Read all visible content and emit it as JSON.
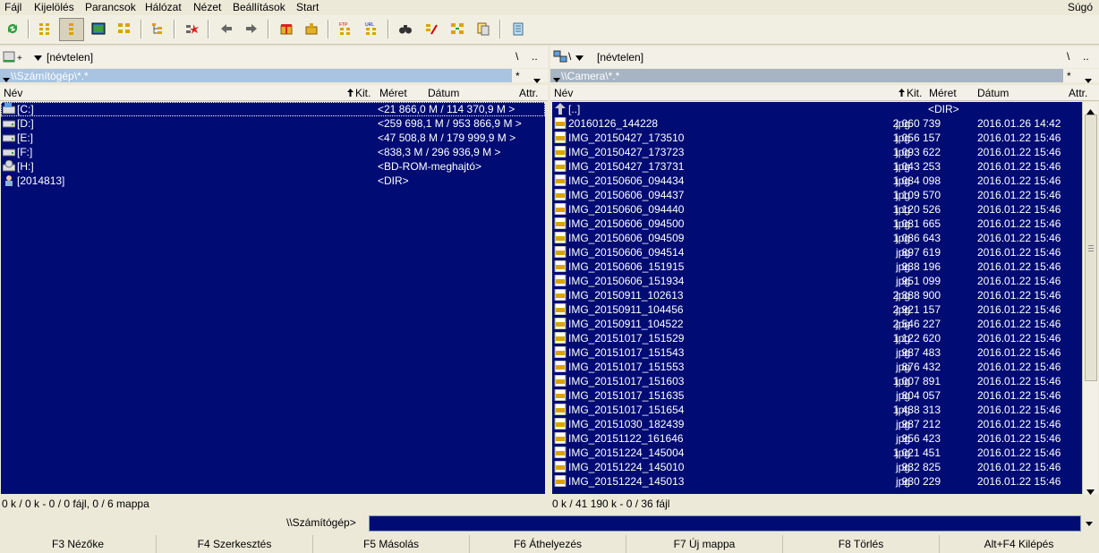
{
  "menu": {
    "items": [
      "Fájl",
      "Kijelölés",
      "Parancsok",
      "Hálózat",
      "Nézet",
      "Beállítások",
      "Start"
    ],
    "help": "Súgó"
  },
  "toolbar": {
    "icons": [
      "refresh-icon",
      "brief-view-icon",
      "detail-view-icon",
      "thumbnail-view-icon",
      "tree-view-icon",
      "invert-selection-icon",
      "back-icon",
      "forward-icon",
      "pack-icon",
      "unpack-icon",
      "ftp-connect-icon",
      "url-connect-icon",
      "find-icon",
      "multi-rename-icon",
      "sync-dirs-icon",
      "copy-names-icon",
      "notepad-icon"
    ]
  },
  "left": {
    "drive_label": "[névtelen]",
    "root_btn": "\\",
    "up_btn": "..",
    "path": "\\\\Számítógép\\*.*",
    "filter_btn": "*",
    "headers": {
      "name": "Név",
      "ext": "Kit.",
      "size": "Méret",
      "date": "Dátum",
      "attr": "Attr."
    },
    "rows": [
      {
        "name": "[C:]",
        "info": "<21 866,0 M / 114 370,9 M >",
        "icon": "drive-c-icon"
      },
      {
        "name": "[D:]",
        "info": "<259 698,1 M / 953 866,9 M >",
        "icon": "hard-drive-icon"
      },
      {
        "name": "[E:]",
        "info": "<47 508,8 M / 179 999,9 M >",
        "icon": "hard-drive-icon"
      },
      {
        "name": "[F:]",
        "info": "<838,3 M / 296 936,9 M >",
        "icon": "hard-drive-icon"
      },
      {
        "name": "[H:]",
        "info": "<BD-ROM-meghajtó>",
        "icon": "optical-drive-icon"
      },
      {
        "name": "[2014813]",
        "info": "<DIR>",
        "icon": "user-folder-icon"
      }
    ],
    "status": "0 k / 0 k - 0 / 0 fájl, 0 / 6 mappa"
  },
  "right": {
    "drive_label": "[névtelen]",
    "root_btn": "\\",
    "up_btn": "..",
    "drive_letter": "\\",
    "path": "\\\\Camera\\*.*",
    "filter_btn": "*",
    "headers": {
      "name": "Név",
      "ext": "Kit.",
      "size": "Méret",
      "date": "Dátum",
      "attr": "Attr."
    },
    "up_row": {
      "name": "[..]",
      "size": "<DIR>"
    },
    "rows": [
      {
        "name": "20160126_144228",
        "ext": "jpg",
        "size": "2 060 739",
        "date": "2016.01.26 14:42"
      },
      {
        "name": "IMG_20150427_173510",
        "ext": "jpg",
        "size": "1 056 157",
        "date": "2016.01.22 15:46"
      },
      {
        "name": "IMG_20150427_173723",
        "ext": "jpg",
        "size": "1 093 622",
        "date": "2016.01.22 15:46"
      },
      {
        "name": "IMG_20150427_173731",
        "ext": "jpg",
        "size": "1 043 253",
        "date": "2016.01.22 15:46"
      },
      {
        "name": "IMG_20150606_094434",
        "ext": "jpg",
        "size": "1 084 098",
        "date": "2016.01.22 15:46"
      },
      {
        "name": "IMG_20150606_094437",
        "ext": "jpg",
        "size": "1 109 570",
        "date": "2016.01.22 15:46"
      },
      {
        "name": "IMG_20150606_094440",
        "ext": "jpg",
        "size": "1 120 526",
        "date": "2016.01.22 15:46"
      },
      {
        "name": "IMG_20150606_094500",
        "ext": "jpg",
        "size": "1 081 665",
        "date": "2016.01.22 15:46"
      },
      {
        "name": "IMG_20150606_094509",
        "ext": "jpg",
        "size": "1 086 643",
        "date": "2016.01.22 15:46"
      },
      {
        "name": "IMG_20150606_094514",
        "ext": "jpg",
        "size": "897 619",
        "date": "2016.01.22 15:46"
      },
      {
        "name": "IMG_20150606_151915",
        "ext": "jpg",
        "size": "938 196",
        "date": "2016.01.22 15:46"
      },
      {
        "name": "IMG_20150606_151934",
        "ext": "jpg",
        "size": "951 099",
        "date": "2016.01.22 15:46"
      },
      {
        "name": "IMG_20150911_102613",
        "ext": "jpg",
        "size": "2 388 900",
        "date": "2016.01.22 15:46"
      },
      {
        "name": "IMG_20150911_104456",
        "ext": "jpg",
        "size": "2 921 157",
        "date": "2016.01.22 15:46"
      },
      {
        "name": "IMG_20150911_104522",
        "ext": "jpg",
        "size": "2 546 227",
        "date": "2016.01.22 15:46"
      },
      {
        "name": "IMG_20151017_151529",
        "ext": "jpg",
        "size": "1 122 620",
        "date": "2016.01.22 15:46"
      },
      {
        "name": "IMG_20151017_151543",
        "ext": "jpg",
        "size": "987 483",
        "date": "2016.01.22 15:46"
      },
      {
        "name": "IMG_20151017_151553",
        "ext": "jpg",
        "size": "876 432",
        "date": "2016.01.22 15:46"
      },
      {
        "name": "IMG_20151017_151603",
        "ext": "jpg",
        "size": "1 007 891",
        "date": "2016.01.22 15:46"
      },
      {
        "name": "IMG_20151017_151635",
        "ext": "jpg",
        "size": "804 057",
        "date": "2016.01.22 15:46"
      },
      {
        "name": "IMG_20151017_151654",
        "ext": "jpg",
        "size": "1 438 313",
        "date": "2016.01.22 15:46"
      },
      {
        "name": "IMG_20151030_182439",
        "ext": "jpg",
        "size": "987 212",
        "date": "2016.01.22 15:46"
      },
      {
        "name": "IMG_20151122_161646",
        "ext": "jpg",
        "size": "956 423",
        "date": "2016.01.22 15:46"
      },
      {
        "name": "IMG_20151224_145004",
        "ext": "jpg",
        "size": "1 021 451",
        "date": "2016.01.22 15:46"
      },
      {
        "name": "IMG_20151224_145010",
        "ext": "jpg",
        "size": "932 825",
        "date": "2016.01.22 15:46"
      },
      {
        "name": "IMG_20151224_145013",
        "ext": "jpg",
        "size": "930 229",
        "date": "2016.01.22 15:46"
      }
    ],
    "status": "0 k / 41 190 k - 0 / 36 fájl"
  },
  "cmdline": {
    "label": "\\\\Számítógép>"
  },
  "fkeys": [
    "F3 Nézőke",
    "F4 Szerkesztés",
    "F5 Másolás",
    "F6 Áthelyezés",
    "F7 Új mappa",
    "F8 Törlés",
    "Alt+F4 Kilépés"
  ],
  "colors": {
    "list_bg": "#000b73",
    "active_path": "#a8c4e0",
    "inactive_path": "#a6b4c3",
    "chrome": "#ece9d8"
  }
}
